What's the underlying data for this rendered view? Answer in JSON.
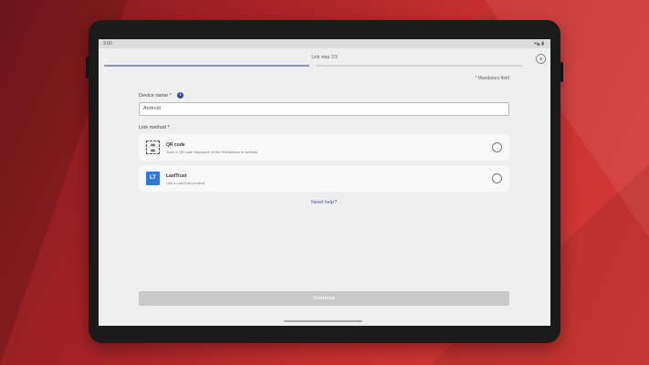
{
  "status_bar": {
    "time": "3:00",
    "icons": "▾◣▮"
  },
  "header": {
    "step_label": "Link step 2/3",
    "close_icon_glyph": "×",
    "progress": 0.5
  },
  "form": {
    "mandatory_note": "* Mandatory field",
    "device_name_label": "Device name *",
    "device_name_value": "Android",
    "info_icon_glyph": "i",
    "link_method_label": "Link method *",
    "options": [
      {
        "icon": "qr-code-icon",
        "icon_glyph": "▦▦\n▦▦",
        "title": "QR code",
        "description": "Scan a QR code displayed on the Richardson to website"
      },
      {
        "icon": "lastpass-icon",
        "icon_glyph": "LT",
        "title": "LastTrust",
        "description": "Use a LastTrust product"
      }
    ],
    "help_link": "Need help?",
    "continue_label": "Continue"
  },
  "colors": {
    "accent": "#3a4a8a",
    "progress": "#8d93b5",
    "brand_blue": "#2d7bd6",
    "disabled_button": "#c9c9c9"
  }
}
